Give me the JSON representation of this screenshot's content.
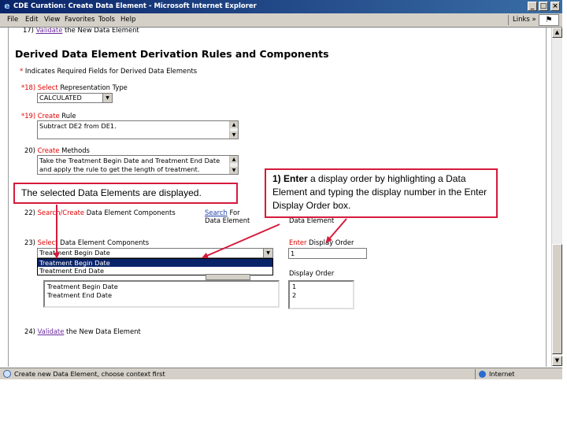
{
  "window": {
    "title": "CDE Curation: Create Data Element - Microsoft Internet Explorer",
    "min_btn": "_",
    "max_btn": "□",
    "close_btn": "×"
  },
  "menu": {
    "items": [
      "File",
      "Edit",
      "View",
      "Favorites",
      "Tools",
      "Help"
    ],
    "links": "Links",
    "links_chevron": "»"
  },
  "form": {
    "step17": {
      "num": "17)",
      "action": "Validate",
      "text": "the New Data Element"
    },
    "heading": "Derived Data Element Derivation Rules and Components",
    "required_note_star": "*",
    "required_note": "Indicates Required Fields for Derived Data Elements",
    "step18": {
      "num": "*18)",
      "action": "Select",
      "text": "Representation Type",
      "value": "CALCULATED"
    },
    "step19": {
      "num": "*19)",
      "action": "Create",
      "text": "Rule",
      "value": "Subtract DE2 from DE1."
    },
    "step20": {
      "num": "20)",
      "action": "Create",
      "text": "Methods",
      "value": "Take the Treatment Begin Date and Treatment End Date and apply the rule to get the length of treatment."
    },
    "step22": {
      "num": "22)",
      "action_partial": "Search/",
      "action": "Create",
      "text": "Data Element Components",
      "search_link": "Search",
      "search_rest1": "For",
      "search_rest2": "Data Element",
      "right_label": "Data Element"
    },
    "step23": {
      "num": "23)",
      "action": "Select",
      "text": "Data Element Components",
      "selected": "Treatment Begin Date",
      "options": [
        "Treatment Begin Date",
        "Treatment End Date"
      ],
      "order_action": "Enter",
      "order_text": "Display Order",
      "order_value": "1",
      "list_label": "Display Order",
      "list_items": [
        "Treatment Begin Date",
        "Treatment End Date"
      ],
      "order_items": [
        "1",
        "2"
      ]
    },
    "step24": {
      "num": "24)",
      "action": "Validate",
      "text": "the New Data Element"
    }
  },
  "callouts": {
    "left": "The selected Data Elements are displayed.",
    "right_lead": "1) Enter",
    "right_text": "a display order by highlighting a Data Element and typing the display number in the Enter Display Order box."
  },
  "status": {
    "text": "Create new Data Element, choose context first",
    "zone": "Internet"
  },
  "colors": {
    "title_bar": "#0a246a",
    "callout_border": "#d61a3c",
    "required_red": "#e00000",
    "visited_link": "#6b2d9e"
  }
}
